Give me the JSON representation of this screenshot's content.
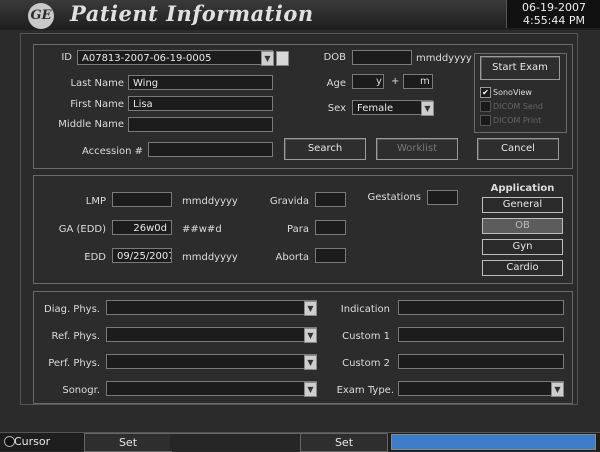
{
  "header": {
    "logo_text": "GE",
    "title": "Patient Information",
    "date": "06-19-2007",
    "time": "4:55:44 PM"
  },
  "patient": {
    "id_label": "ID",
    "id_value": "A07813-2007-06-19-0005",
    "last_name_label": "Last Name",
    "last_name": "Wing",
    "first_name_label": "First Name",
    "first_name": "Lisa",
    "middle_name_label": "Middle Name",
    "middle_name": "",
    "accession_label": "Accession #",
    "accession": "",
    "dob_label": "DOB",
    "dob": "",
    "dob_format": "mmddyyyy",
    "age_label": "Age",
    "age_years": "",
    "age_years_unit": "y",
    "age_plus": "+",
    "age_months": "",
    "age_months_unit": "m",
    "sex_label": "Sex",
    "sex": "Female"
  },
  "buttons": {
    "search": "Search",
    "worklist": "Worklist",
    "start_exam": "Start Exam",
    "cancel": "Cancel"
  },
  "options": {
    "sonoview": "SonoView",
    "sonoview_checked": "✔",
    "dicom_send": "DICOM Send",
    "dicom_print": "DICOM Print"
  },
  "ob": {
    "lmp_label": "LMP",
    "lmp": "",
    "lmp_format": "mmddyyyy",
    "ga_label": "GA (EDD)",
    "ga": "26w0d",
    "ga_format": "##w#d",
    "edd_label": "EDD",
    "edd": "09/25/2007",
    "edd_format": "mmddyyyy",
    "gravida_label": "Gravida",
    "gravida": "",
    "para_label": "Para",
    "para": "",
    "aborta_label": "Aborta",
    "aborta": "",
    "gestations_label": "Gestations",
    "gestations": ""
  },
  "application": {
    "title": "Application",
    "items": [
      "General",
      "OB",
      "Gyn",
      "Cardio"
    ],
    "active": "OB"
  },
  "staff": {
    "diag_label": "Diag. Phys.",
    "diag": "",
    "ref_label": "Ref. Phys.",
    "ref": "",
    "perf_label": "Perf. Phys.",
    "perf": "",
    "sonogr_label": "Sonogr.",
    "sonogr": "",
    "indication_label": "Indication",
    "indication": "",
    "custom1_label": "Custom 1",
    "custom1": "",
    "custom2_label": "Custom 2",
    "custom2": "",
    "exam_type_label": "Exam Type.",
    "exam_type": ""
  },
  "footer": {
    "cursor": "Cursor",
    "set1": "Set",
    "set2": "Set"
  },
  "colors": {
    "progress": "#3d7cc9"
  }
}
